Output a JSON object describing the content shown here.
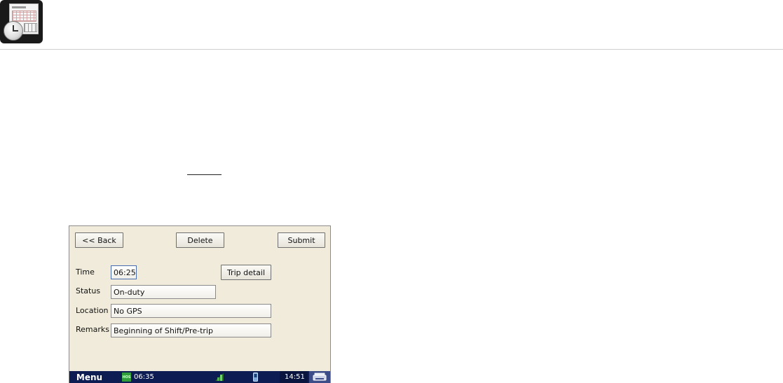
{
  "device": {
    "buttons": {
      "back": "<< Back",
      "delete": "Delete",
      "submit": "Submit",
      "trip_detail": "Trip detail"
    },
    "form": {
      "time_label": "Time",
      "time_value": "06:25",
      "status_label": "Status",
      "status_value": "On-duty",
      "location_label": "Location",
      "location_value": "No GPS",
      "remarks_label": "Remarks",
      "remarks_value": "Beginning of Shift/Pre-trip"
    },
    "taskbar": {
      "menu_label": "Menu",
      "hos_badge": "HOS",
      "hos_time": "06:35",
      "clock": "14:51"
    }
  },
  "colors": {
    "screen_bg": "#f0ebda",
    "taskbar_bg": "#0d1c52",
    "hos_green": "#2f9e3a"
  }
}
